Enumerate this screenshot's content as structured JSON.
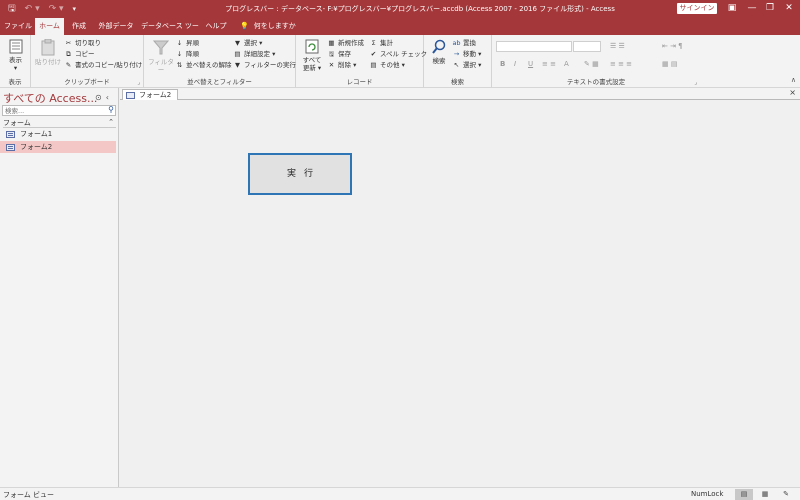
{
  "titlebar": {
    "title": "プログレスバー : データベース- F:¥プログレスバー¥プログレスバー.accdb (Access 2007 - 2016 ファイル形式)  -  Access",
    "signin": "サインイン",
    "qat": {
      "save_icon": "save-icon",
      "undo_icon": "undo-icon",
      "redo_icon": "redo-icon",
      "customize_icon": "customize-icon"
    },
    "controls": {
      "minimize": "—",
      "restore": "❐",
      "close": "✕",
      "ribbon_display": "▣"
    }
  },
  "tabs": [
    {
      "label": "ファイル"
    },
    {
      "label": "ホーム"
    },
    {
      "label": "作成"
    },
    {
      "label": "外部データ"
    },
    {
      "label": "データベース ツール"
    },
    {
      "label": "ヘルプ"
    },
    {
      "label": "何をしますか"
    }
  ],
  "ribbon": {
    "view": {
      "label": "表示",
      "group": "表示"
    },
    "clipboard": {
      "paste": "貼り付け",
      "cut": "切り取り",
      "copy": "コピー",
      "format_painter": "書式のコピー/貼り付け",
      "group": "クリップボード"
    },
    "sort": {
      "filter": "フィルター",
      "ascending": "昇順",
      "descending": "降順",
      "clear_sort": "並べ替えの解除",
      "selection": "選択",
      "advanced": "詳細設定",
      "toggle_filter": "フィルターの実行",
      "group": "並べ替えとフィルター"
    },
    "records": {
      "refresh_all": "すべて\n更新",
      "refresh_line1": "すべて",
      "refresh_line2": "更新",
      "new": "新規作成",
      "save": "保存",
      "delete": "削除",
      "totals": "集計",
      "spelling": "スペル チェック",
      "more": "その他",
      "group": "レコード"
    },
    "find": {
      "find": "検索",
      "replace": "置換",
      "goto": "移動",
      "select": "選択",
      "group": "検索"
    },
    "text": {
      "group": "テキストの書式設定",
      "bold": "B",
      "italic": "I",
      "underline": "U",
      "font_color": "A"
    }
  },
  "nav": {
    "title": "すべての Access...",
    "search_placeholder": "検索...",
    "section": "フォーム",
    "items": [
      {
        "label": "フォーム1",
        "selected": false
      },
      {
        "label": "フォーム2",
        "selected": true
      }
    ]
  },
  "document": {
    "tab": "フォーム2",
    "close": "×",
    "run_button": "実行"
  },
  "status": {
    "left": "フォーム ビュー",
    "numlock": "NumLock"
  },
  "colors": {
    "accent": "#a4373a",
    "selection": "#f4c7c7",
    "button_border": "#2e75b6"
  }
}
